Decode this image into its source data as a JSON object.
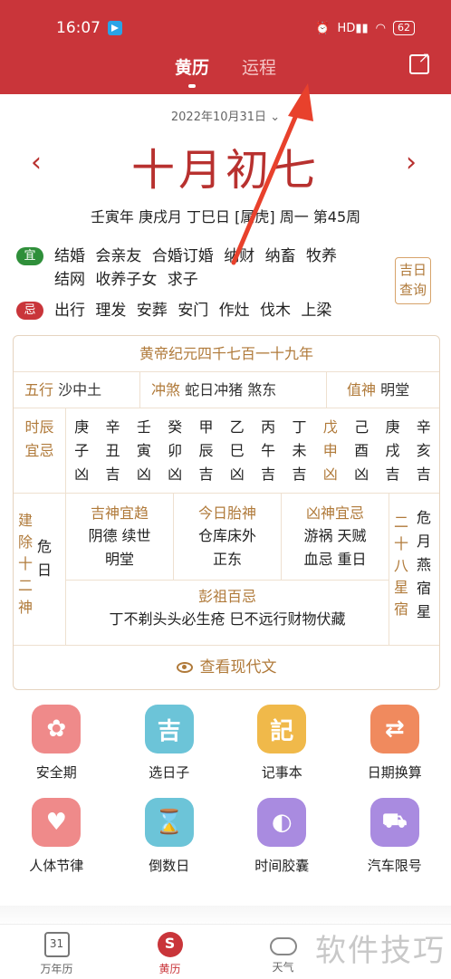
{
  "status_bar": {
    "time": "16:07",
    "battery": "62",
    "hd": "HD"
  },
  "top_tabs": [
    "黄历",
    "运程"
  ],
  "date_line": "2022年10月31日",
  "lunar_date": "十月初七",
  "ganzhi_line": "壬寅年 庚戌月 丁巳日 [属虎] 周一 第45周",
  "yi": {
    "badge": "宜",
    "items": "结婚 会亲友 合婚订婚 纳财 纳畜 牧养 结网 收养子女 求子"
  },
  "ji": {
    "badge": "忌",
    "items": "出行 理发 安葬 安门 作灶 伐木 上梁"
  },
  "jiri_button": "吉日查询",
  "era": "黄帝纪元四千七百一十九年",
  "wuxing": {
    "label": "五行",
    "value": "沙中土"
  },
  "chongsha": {
    "label": "冲煞",
    "value": "蛇日冲猪 煞东"
  },
  "zhishen": {
    "label": "值神",
    "value": "明堂"
  },
  "hours_label": [
    "时辰",
    "宜忌"
  ],
  "hours": [
    {
      "top": "庚",
      "mid": "子",
      "bot": "凶"
    },
    {
      "top": "辛",
      "mid": "丑",
      "bot": "吉"
    },
    {
      "top": "壬",
      "mid": "寅",
      "bot": "凶"
    },
    {
      "top": "癸",
      "mid": "卯",
      "bot": "凶"
    },
    {
      "top": "甲",
      "mid": "辰",
      "bot": "吉"
    },
    {
      "top": "乙",
      "mid": "巳",
      "bot": "凶"
    },
    {
      "top": "丙",
      "mid": "午",
      "bot": "吉"
    },
    {
      "top": "丁",
      "mid": "未",
      "bot": "吉"
    },
    {
      "top": "戊",
      "mid": "申",
      "bot": "凶"
    },
    {
      "top": "己",
      "mid": "酉",
      "bot": "凶"
    },
    {
      "top": "庚",
      "mid": "戌",
      "bot": "吉"
    },
    {
      "top": "辛",
      "mid": "亥",
      "bot": "吉"
    }
  ],
  "jianchu": {
    "label": [
      "建",
      "除",
      "十",
      "二",
      "神"
    ],
    "value": "危日"
  },
  "jishen": {
    "title": "吉神宜趋",
    "lines": [
      "阴德 续世",
      "明堂"
    ]
  },
  "taishen": {
    "title": "今日胎神",
    "lines": [
      "仓库床外",
      "正东"
    ]
  },
  "xiongshen": {
    "title": "凶神宜忌",
    "lines": [
      "游祸 天贼",
      "血忌 重日"
    ]
  },
  "xiu": {
    "label": [
      "二",
      "十",
      "八",
      "星",
      "宿"
    ],
    "value": [
      "危",
      "月",
      "燕",
      "宿",
      "星"
    ]
  },
  "pengzu": {
    "title": "彭祖百忌",
    "text": "丁不剃头头必生疮 巳不远行财物伏藏"
  },
  "modern_button": "查看现代文",
  "tools": [
    {
      "label": "安全期",
      "glyph": "✿",
      "color": "#ef8a8a"
    },
    {
      "label": "选日子",
      "glyph": "吉",
      "color": "#6cc4d8"
    },
    {
      "label": "记事本",
      "glyph": "記",
      "color": "#f0b94a"
    },
    {
      "label": "日期换算",
      "glyph": "⇄",
      "color": "#f08a5e"
    },
    {
      "label": "人体节律",
      "glyph": "♥",
      "color": "#ef8a8a"
    },
    {
      "label": "倒数日",
      "glyph": "⌛",
      "color": "#6cc4d8"
    },
    {
      "label": "时间胶囊",
      "glyph": "◐",
      "color": "#a98be0"
    },
    {
      "label": "汽车限号",
      "glyph": "🚗",
      "color": "#a98be0"
    }
  ],
  "bottom_nav": [
    {
      "label": "万年历",
      "icon": "31"
    },
    {
      "label": "黄历"
    },
    {
      "label": "天气"
    }
  ],
  "watermark": "软件技巧",
  "colors": {
    "primary": "#c9353a",
    "gold": "#b07a3a",
    "green": "#2f8f3a"
  }
}
